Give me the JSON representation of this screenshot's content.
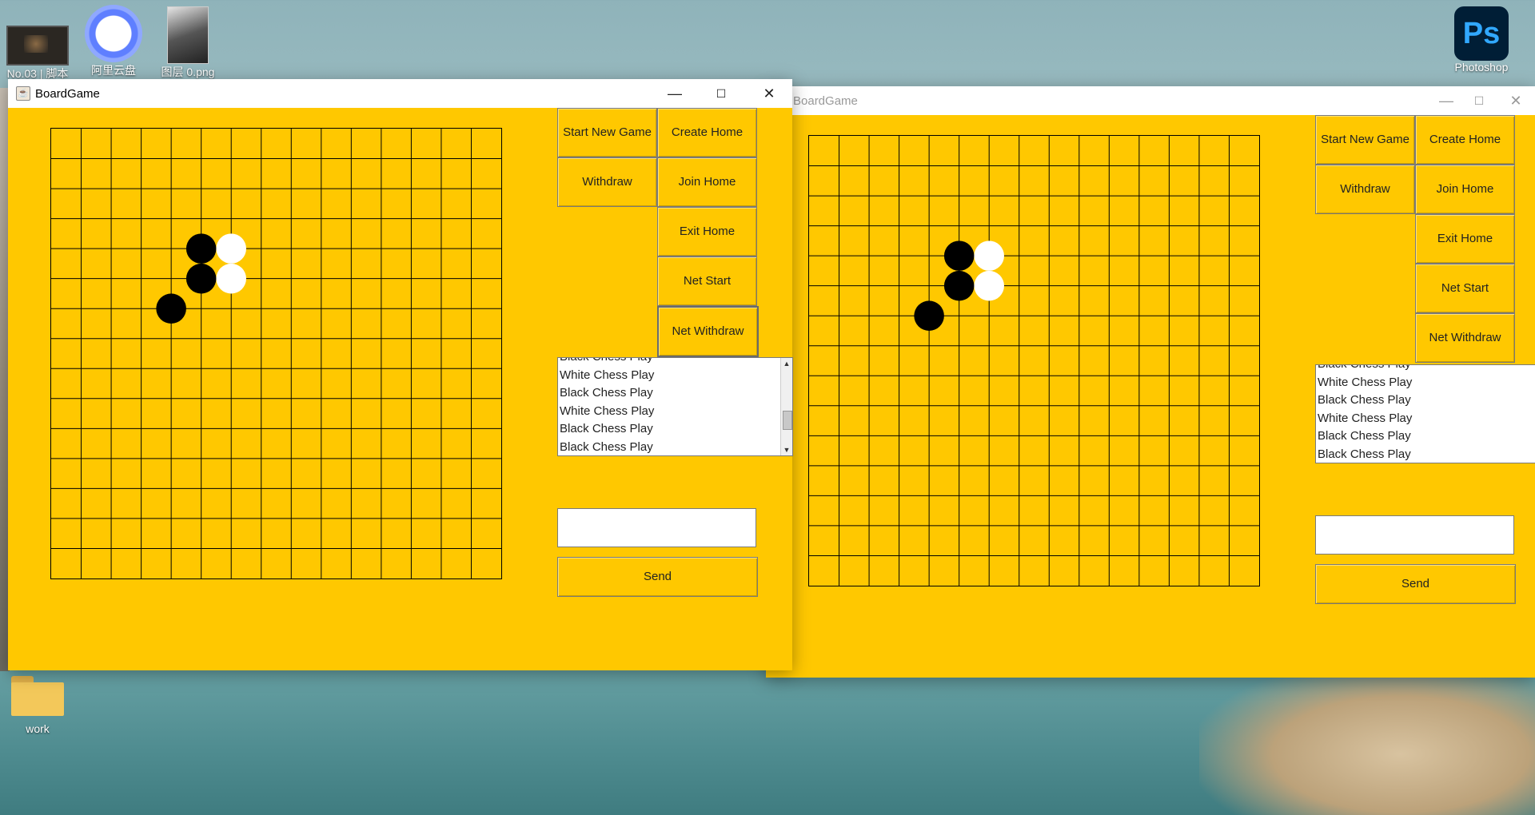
{
  "desktop": {
    "icons": [
      {
        "label": "No.03 | 脚本"
      },
      {
        "label": "阿里云盘"
      },
      {
        "label": "图层 0.png"
      },
      {
        "label": "Photoshop"
      },
      {
        "label": "work"
      }
    ],
    "ps_glyph": "Ps"
  },
  "windows": [
    {
      "title": "BoardGame",
      "state": "active",
      "controls": {
        "minimize": "—",
        "maximize": "☐",
        "close": "✕"
      },
      "buttons": {
        "start_new_game": "Start New Game",
        "create_home": "Create Home",
        "withdraw": "Withdraw",
        "join_home": "Join Home",
        "exit_home": "Exit Home",
        "net_start": "Net Start",
        "net_withdraw": "Net Withdraw",
        "send": "Send"
      },
      "log": [
        "Black Chess Play",
        "White Chess Play",
        "Black Chess Play",
        "White Chess Play",
        "Black Chess Play",
        "Black Chess Play"
      ],
      "message_input": ""
    },
    {
      "title": "BoardGame",
      "state": "inactive",
      "controls": {
        "minimize": "—",
        "maximize": "☐",
        "close": "✕"
      },
      "buttons": {
        "start_new_game": "Start New Game",
        "create_home": "Create Home",
        "withdraw": "Withdraw",
        "join_home": "Join Home",
        "exit_home": "Exit Home",
        "net_start": "Net Start",
        "net_withdraw": "Net Withdraw",
        "send": "Send"
      },
      "log": [
        "Black Chess Play",
        "White Chess Play",
        "Black Chess Play",
        "White Chess Play",
        "Black Chess Play",
        "Black Chess Play"
      ],
      "message_input": ""
    }
  ],
  "board": {
    "size": 15,
    "colors": {
      "background": "#ffc800",
      "lines": "#000000",
      "black": "#000000",
      "white": "#ffffff"
    },
    "stones": [
      {
        "col": 5,
        "row": 4,
        "color": "black"
      },
      {
        "col": 6,
        "row": 4,
        "color": "white"
      },
      {
        "col": 5,
        "row": 5,
        "color": "black"
      },
      {
        "col": 6,
        "row": 5,
        "color": "white"
      },
      {
        "col": 4,
        "row": 6,
        "color": "black"
      }
    ]
  }
}
